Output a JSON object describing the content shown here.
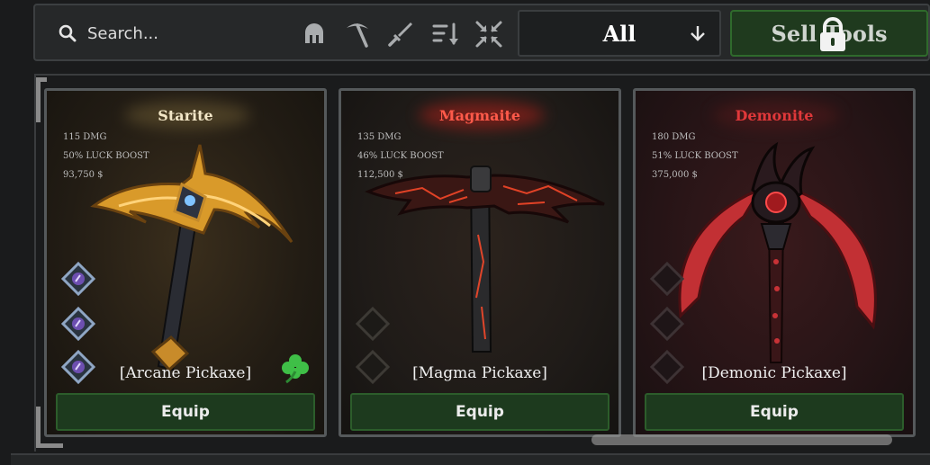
{
  "search": {
    "placeholder": "Search..."
  },
  "toolbar": {
    "icons": [
      "helmet-icon",
      "pickaxe-icon",
      "sword-icon",
      "sort-icon",
      "collapse-icon"
    ],
    "filter_label": "All",
    "sell_label": "Sell Tools"
  },
  "cards": [
    {
      "title": "Starite",
      "title_color": "#f3e7c8",
      "damage": "115 DMG",
      "luck": "50% LUCK BOOST",
      "price": "93,750 $",
      "name": "[Arcane Pickaxe]",
      "equip_label": "Equip",
      "filled_runes": 3
    },
    {
      "title": "Magmaite",
      "title_color": "#ff5a4a",
      "damage": "135 DMG",
      "luck": "46% LUCK BOOST",
      "price": "112,500 $",
      "name": "[Magma Pickaxe]",
      "equip_label": "Equip",
      "filled_runes": 0
    },
    {
      "title": "Demonite",
      "title_color": "#e0383a",
      "damage": "180 DMG",
      "luck": "51% LUCK BOOST",
      "price": "375,000 $",
      "name": "[Demonic Pickaxe]",
      "equip_label": "Equip",
      "filled_runes": 0
    }
  ]
}
